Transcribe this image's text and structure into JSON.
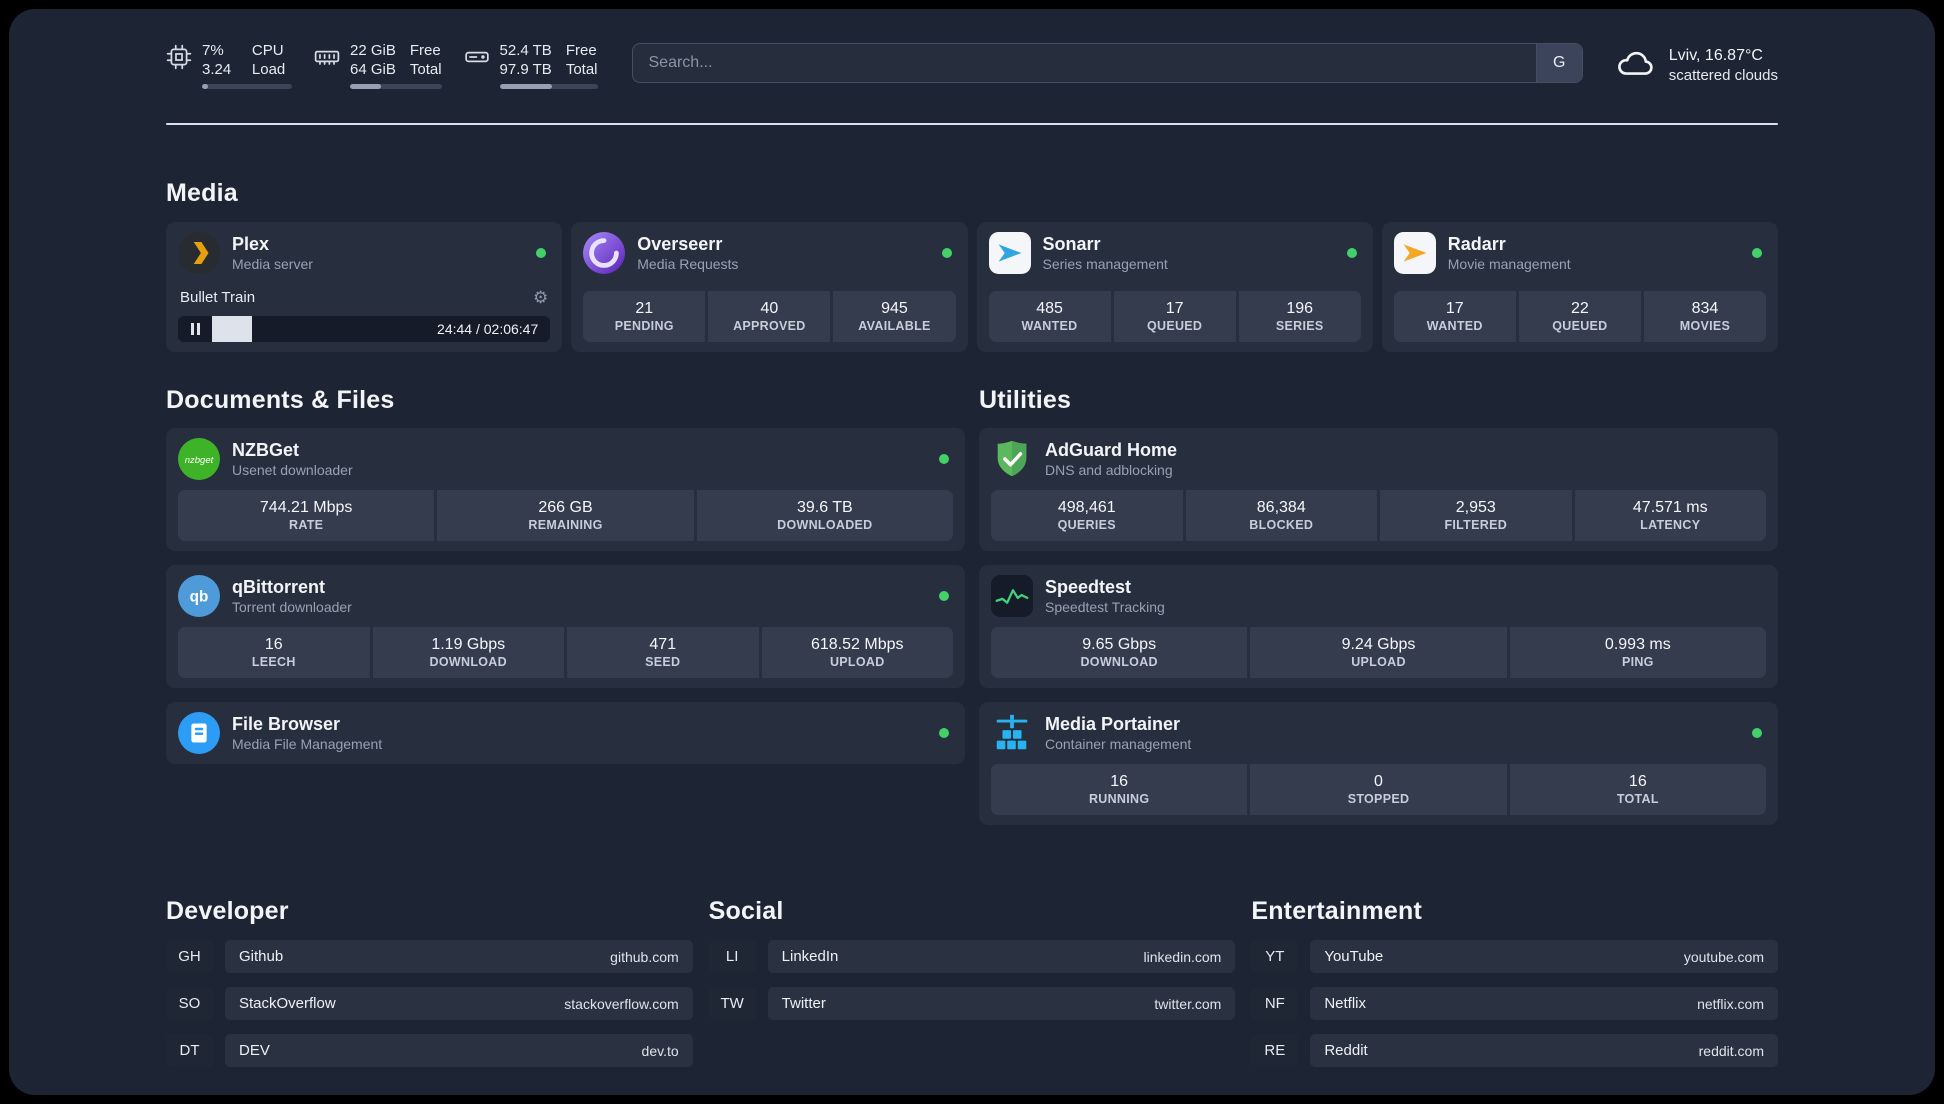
{
  "topbar": {
    "metrics": [
      {
        "icon": "cpu-icon",
        "value_top": "7%",
        "value_bottom": "3.24",
        "label_top": "CPU",
        "label_bottom": "Load",
        "percent": 7
      },
      {
        "icon": "ram-icon",
        "value_top": "22 GiB",
        "value_bottom": "64 GiB",
        "label_top": "Free",
        "label_bottom": "Total",
        "percent": 34
      },
      {
        "icon": "disk-icon",
        "value_top": "52.4 TB",
        "value_bottom": "97.9 TB",
        "label_top": "Free",
        "label_bottom": "Total",
        "percent": 54
      }
    ],
    "search": {
      "placeholder": "Search...",
      "engine_label": "G"
    },
    "weather": {
      "location": "Lviv, 16.87°C",
      "condition": "scattered clouds"
    }
  },
  "sections": {
    "media": "Media",
    "documents": "Documents & Files",
    "utilities": "Utilities",
    "developer": "Developer",
    "social": "Social",
    "entertainment": "Entertainment"
  },
  "apps": {
    "plex": {
      "name": "Plex",
      "subtitle": "Media server",
      "now_playing": "Bullet Train",
      "time": "24:44 / 02:06:47",
      "progress_percent": 19
    },
    "overseerr": {
      "name": "Overseerr",
      "subtitle": "Media Requests",
      "stats": [
        {
          "value": "21",
          "label": "PENDING"
        },
        {
          "value": "40",
          "label": "APPROVED"
        },
        {
          "value": "945",
          "label": "AVAILABLE"
        }
      ]
    },
    "sonarr": {
      "name": "Sonarr",
      "subtitle": "Series management",
      "stats": [
        {
          "value": "485",
          "label": "WANTED"
        },
        {
          "value": "17",
          "label": "QUEUED"
        },
        {
          "value": "196",
          "label": "SERIES"
        }
      ]
    },
    "radarr": {
      "name": "Radarr",
      "subtitle": "Movie management",
      "stats": [
        {
          "value": "17",
          "label": "WANTED"
        },
        {
          "value": "22",
          "label": "QUEUED"
        },
        {
          "value": "834",
          "label": "MOVIES"
        }
      ]
    },
    "nzbget": {
      "name": "NZBGet",
      "subtitle": "Usenet downloader",
      "stats": [
        {
          "value": "744.21 Mbps",
          "label": "RATE"
        },
        {
          "value": "266 GB",
          "label": "REMAINING"
        },
        {
          "value": "39.6 TB",
          "label": "DOWNLOADED"
        }
      ]
    },
    "qbittorrent": {
      "name": "qBittorrent",
      "subtitle": "Torrent downloader",
      "stats": [
        {
          "value": "16",
          "label": "LEECH"
        },
        {
          "value": "1.19 Gbps",
          "label": "DOWNLOAD"
        },
        {
          "value": "471",
          "label": "SEED"
        },
        {
          "value": "618.52 Mbps",
          "label": "UPLOAD"
        }
      ]
    },
    "filebrowser": {
      "name": "File Browser",
      "subtitle": "Media File Management"
    },
    "adguard": {
      "name": "AdGuard Home",
      "subtitle": "DNS and adblocking",
      "stats": [
        {
          "value": "498,461",
          "label": "QUERIES"
        },
        {
          "value": "86,384",
          "label": "BLOCKED"
        },
        {
          "value": "2,953",
          "label": "FILTERED"
        },
        {
          "value": "47.571 ms",
          "label": "LATENCY"
        }
      ]
    },
    "speedtest": {
      "name": "Speedtest",
      "subtitle": "Speedtest Tracking",
      "stats": [
        {
          "value": "9.65 Gbps",
          "label": "DOWNLOAD"
        },
        {
          "value": "9.24 Gbps",
          "label": "UPLOAD"
        },
        {
          "value": "0.993 ms",
          "label": "PING"
        }
      ]
    },
    "portainer": {
      "name": "Media Portainer",
      "subtitle": "Container management",
      "stats": [
        {
          "value": "16",
          "label": "RUNNING"
        },
        {
          "value": "0",
          "label": "STOPPED"
        },
        {
          "value": "16",
          "label": "TOTAL"
        }
      ]
    }
  },
  "icon_labels": {
    "nzbget": "nzbget",
    "qbittorrent": "qb"
  },
  "links": {
    "developer": [
      {
        "abbr": "GH",
        "name": "Github",
        "url": "github.com"
      },
      {
        "abbr": "SO",
        "name": "StackOverflow",
        "url": "stackoverflow.com"
      },
      {
        "abbr": "DT",
        "name": "DEV",
        "url": "dev.to"
      }
    ],
    "social": [
      {
        "abbr": "LI",
        "name": "LinkedIn",
        "url": "linkedin.com"
      },
      {
        "abbr": "TW",
        "name": "Twitter",
        "url": "twitter.com"
      }
    ],
    "entertainment": [
      {
        "abbr": "YT",
        "name": "YouTube",
        "url": "youtube.com"
      },
      {
        "abbr": "NF",
        "name": "Netflix",
        "url": "netflix.com"
      },
      {
        "abbr": "RE",
        "name": "Reddit",
        "url": "reddit.com"
      }
    ]
  },
  "colors": {
    "status_online": "#43cf6a",
    "panel_bg": "#1d2433",
    "card_bg": "#272e3e",
    "tile_bg": "#343c4e",
    "plex_amber": "#e6a00e",
    "sonarr_blue": "#31a5dd",
    "radarr_amber": "#f5a623",
    "overseerr_purple": "#6d28d9",
    "nzbget_green": "#3eb327",
    "qbittorrent_blue": "#4f9bd9",
    "filebrowser_blue": "#2d9cf5",
    "adguard_green": "#5cb85c",
    "speedtest_green": "#44d07b",
    "portainer_blue": "#27b3ef"
  }
}
